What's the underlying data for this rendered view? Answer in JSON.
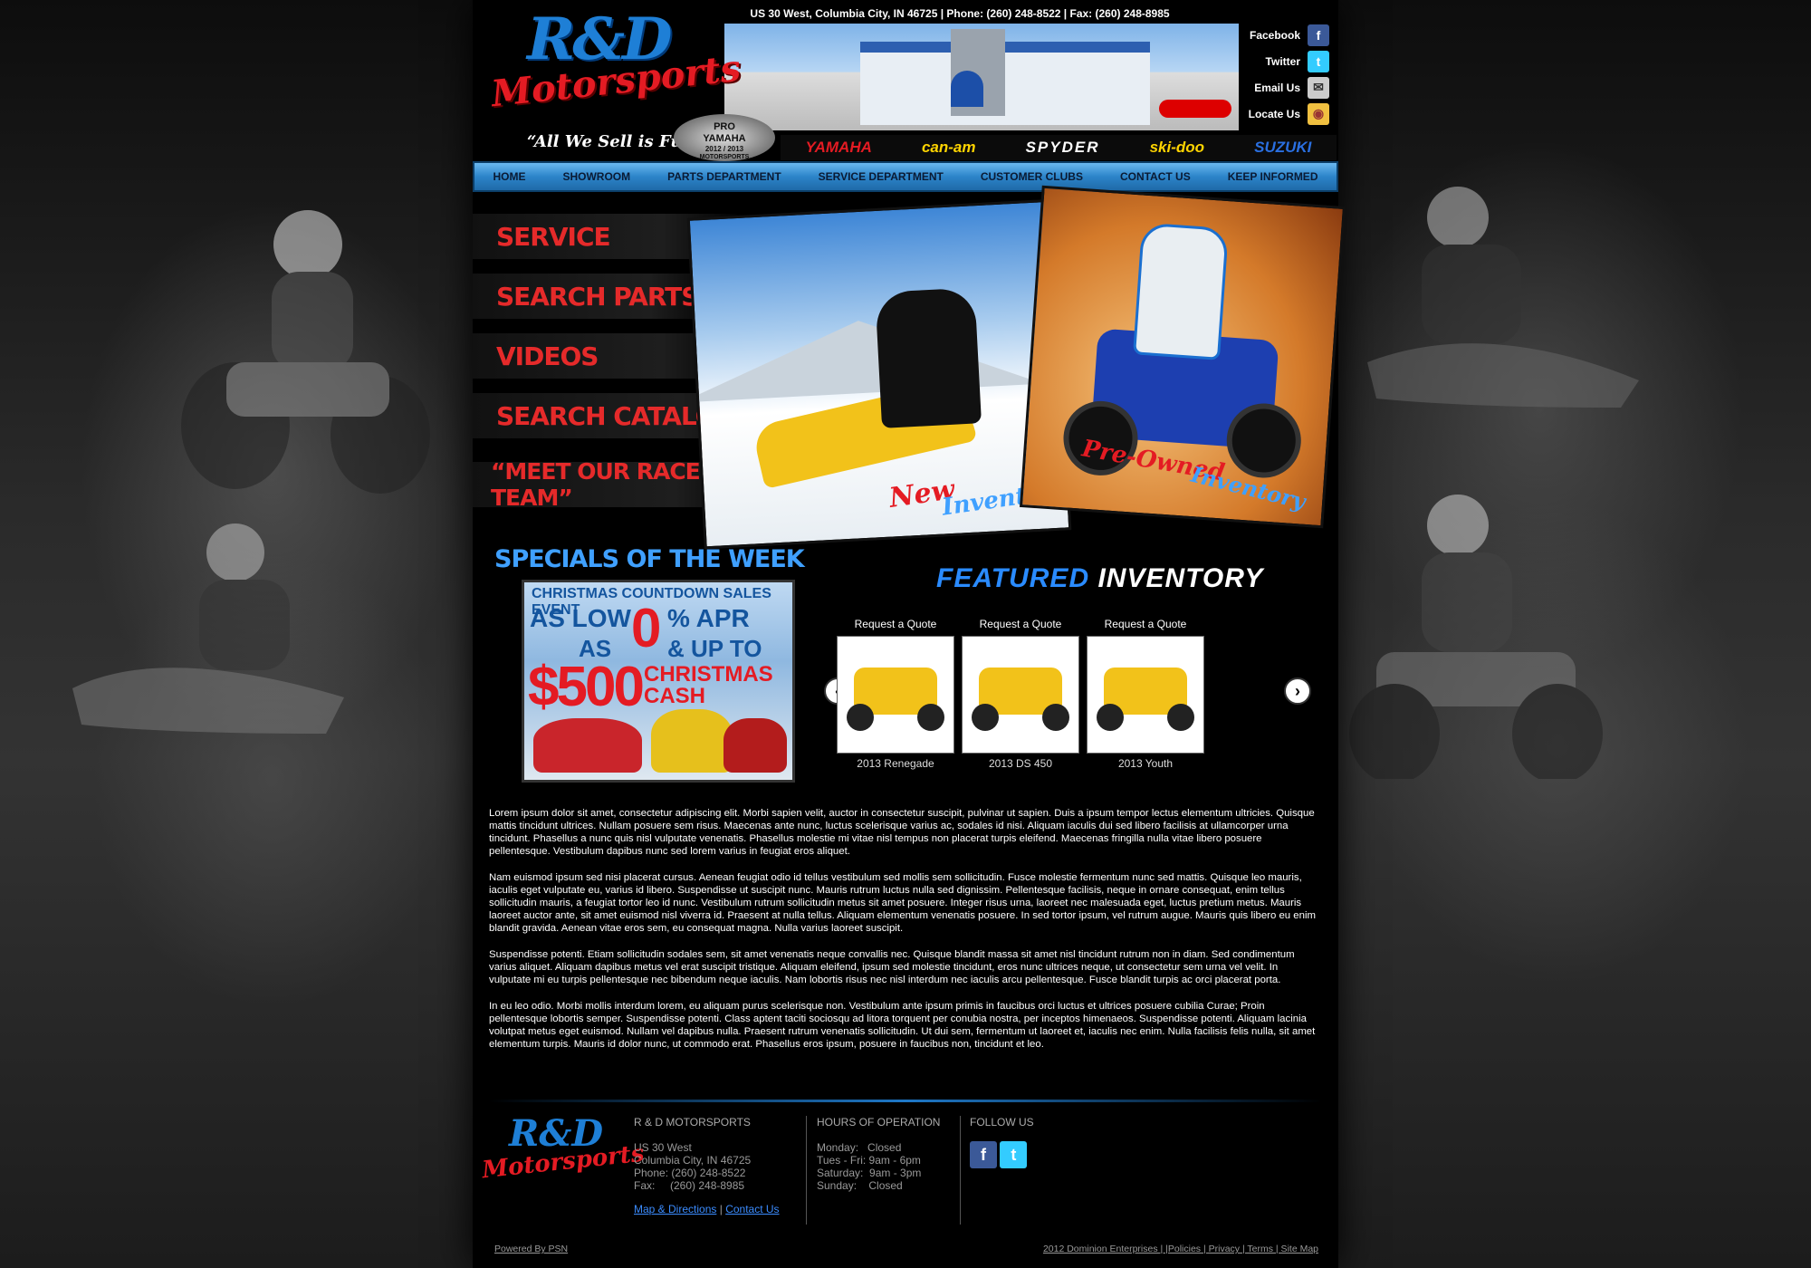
{
  "header": {
    "address_line": "US 30 West, Columbia City, IN 46725 | Phone: (260) 248-8522 | Fax: (260) 248-8985",
    "logo_rd": "R&D",
    "logo_motorsports": "Motorsports",
    "slogan": "“All We Sell is Fun”",
    "badge": {
      "line1": "PRO",
      "line2": "YAMAHA",
      "line3": "2012 / 2013",
      "line4": "MOTORSPORTS"
    }
  },
  "social": [
    {
      "label": "Facebook",
      "icon": "facebook-icon",
      "glyph": "f",
      "color": "#3b5998"
    },
    {
      "label": "Twitter",
      "icon": "twitter-icon",
      "glyph": "t",
      "color": "#33ccff"
    },
    {
      "label": "Email Us",
      "icon": "envelope-icon",
      "glyph": "✉",
      "color": "#cccccc"
    },
    {
      "label": "Locate Us",
      "icon": "map-icon",
      "glyph": "◉",
      "color": "#f0c040"
    }
  ],
  "brands": [
    {
      "name": "YAMAHA",
      "color": "#e41b23"
    },
    {
      "name": "can-am",
      "color": "#ffd400"
    },
    {
      "name": "SPYDER",
      "color": "#ffffff"
    },
    {
      "name": "ski-doo",
      "color": "#ffd400"
    },
    {
      "name": "SUZUKI",
      "color": "#2a6fe0"
    }
  ],
  "nav": [
    "HOME",
    "SHOWROOM",
    "PARTS DEPARTMENT",
    "SERVICE DEPARTMENT",
    "CUSTOMER CLUBS",
    "CONTACT US",
    "KEEP INFORMED"
  ],
  "side_menu": [
    "SERVICE",
    "SEARCH PARTS",
    "VIDEOS",
    "SEARCH CATALOGS",
    "“MEET OUR RACE TEAM”"
  ],
  "hero": {
    "new_1": "New",
    "new_2": "Inventory",
    "pre_1": "Pre-Owned",
    "pre_2": "Inventory"
  },
  "specials": {
    "title": "SPECIALS OF THE WEEK",
    "promo_line1": "CHRISTMAS COUNTDOWN SALES EVENT",
    "promo_aslow": "AS LOW",
    "promo_zero": "0",
    "promo_apr": "% APR",
    "promo_as": "AS",
    "promo_upto": "& UP TO",
    "promo_500": "$500",
    "promo_cash": "CHRISTMAS CASH"
  },
  "featured": {
    "title_a": "FEATURED",
    "title_b": "INVENTORY",
    "items": [
      {
        "link": "Request a Quote",
        "caption": "2013 Renegade",
        "color": "#f2c21a"
      },
      {
        "link": "Request a Quote",
        "caption": "2013 DS 450",
        "color": "#f2c21a"
      },
      {
        "link": "Request a Quote",
        "caption": "2013 Youth",
        "color": "#f2c21a"
      }
    ],
    "prev": "‹",
    "next": "›"
  },
  "content": [
    "Lorem ipsum dolor sit amet, consectetur adipiscing elit. Morbi sapien velit, auctor in consectetur suscipit, pulvinar ut sapien. Duis a ipsum tempor lectus elementum ultricies. Quisque mattis tincidunt ultrices. Nullam posuere sem risus. Maecenas ante nunc, luctus scelerisque varius ac, sodales id nisi. Aliquam iaculis dui sed libero facilisis at ullamcorper urna tincidunt. Phasellus a nunc quis nisl vulputate venenatis. Phasellus molestie mi vitae nisl tempus non placerat turpis eleifend. Maecenas fringilla nulla vitae libero posuere pellentesque. Vestibulum dapibus nunc sed lorem varius in feugiat eros aliquet.",
    "Nam euismod ipsum sed nisi placerat cursus. Aenean feugiat odio id tellus vestibulum sed mollis sem sollicitudin. Fusce molestie fermentum nunc sed mattis. Quisque leo mauris, iaculis eget vulputate eu, varius id libero. Suspendisse ut suscipit nunc. Mauris rutrum luctus nulla sed dignissim. Pellentesque facilisis, neque in ornare consequat, enim tellus sollicitudin mauris, a feugiat tortor leo id nunc. Vestibulum rutrum sollicitudin metus sit amet posuere. Integer risus urna, laoreet nec malesuada eget, luctus pretium metus. Mauris laoreet auctor ante, sit amet euismod nisl viverra id. Praesent at nulla tellus. Aliquam elementum venenatis posuere. In sed tortor ipsum, vel rutrum augue. Mauris quis libero eu enim blandit gravida. Aenean vitae eros sem, eu consequat magna. Nulla varius laoreet suscipit.",
    "Suspendisse potenti. Etiam sollicitudin sodales sem, sit amet venenatis neque convallis nec. Quisque blandit massa sit amet nisl tincidunt rutrum non in diam. Sed condimentum varius aliquet. Aliquam dapibus metus vel erat suscipit tristique. Aliquam eleifend, ipsum sed molestie tincidunt, eros nunc ultrices neque, ut consectetur sem urna vel velit. In vulputate mi eu turpis pellentesque nec bibendum neque iaculis. Nam lobortis risus nec nisl interdum nec iaculis arcu pellentesque. Fusce blandit turpis ac orci placerat porta.",
    "In eu leo odio. Morbi mollis interdum lorem, eu aliquam purus scelerisque non. Vestibulum ante ipsum primis in faucibus orci luctus et ultrices posuere cubilia Curae; Proin pellentesque lobortis semper. Suspendisse potenti. Class aptent taciti sociosqu ad litora torquent per conubia nostra, per inceptos himenaeos. Suspendisse potenti. Aliquam lacinia volutpat metus eget euismod. Nullam vel dapibus nulla. Praesent rutrum venenatis sollicitudin. Ut dui sem, fermentum ut laoreet et, iaculis nec enim. Nulla facilisis felis nulla, sit amet elementum turpis. Mauris id dolor nunc, ut commodo erat. Phasellus eros ipsum, posuere in faucibus non, tincidunt et leo."
  ],
  "footer": {
    "company_heading": "R & D MOTORSPORTS",
    "address1": "US 30 West",
    "address2": "Columbia City, IN 46725",
    "phone": "Phone: (260) 248-8522",
    "fax": "Fax:     (260) 248-8985",
    "map_link": "Map & Directions",
    "sep": "|",
    "contact_link": "Contact Us",
    "hours_heading": "HOURS OF OPERATION",
    "hours": [
      "Monday:   Closed",
      "Tues - Fri: 9am - 6pm",
      "Saturday:  9am - 3pm",
      "Sunday:    Closed"
    ],
    "follow_heading": "FOLLOW US",
    "powered": "Powered By PSN",
    "legal": "2012 Dominion Enterprises | |Policies | Privacy | Terms | Site Map"
  }
}
